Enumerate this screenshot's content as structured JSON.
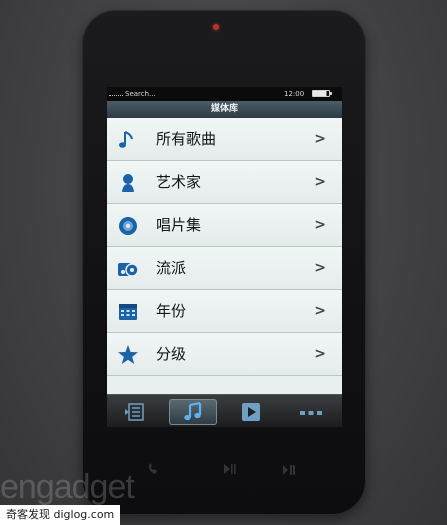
{
  "status_bar": {
    "search_label": "Search...",
    "time": "12:00",
    "battery_icon": "battery-icon"
  },
  "header": {
    "title": "媒体库"
  },
  "menu": {
    "items": [
      {
        "label": "所有歌曲",
        "icon": "music-note-icon",
        "chevron": ">"
      },
      {
        "label": "艺术家",
        "icon": "artist-icon",
        "chevron": ">"
      },
      {
        "label": "唱片集",
        "icon": "album-icon",
        "chevron": ">"
      },
      {
        "label": "流派",
        "icon": "genre-icon",
        "chevron": ">"
      },
      {
        "label": "年份",
        "icon": "calendar-icon",
        "chevron": ">"
      },
      {
        "label": "分级",
        "icon": "star-icon",
        "chevron": ">"
      }
    ]
  },
  "tab_bar": {
    "tabs": [
      {
        "icon": "playlist-icon"
      },
      {
        "icon": "music-note-icon",
        "active": true
      },
      {
        "icon": "video-icon"
      },
      {
        "icon": "more-icon"
      }
    ]
  },
  "watermarks": {
    "site_logo": "engadget",
    "site_caption": "奇客发现 diglog.com"
  },
  "colors": {
    "accent_icon": "#1b63a8",
    "list_background": "#e8efee",
    "title_bar": "#2c3a43"
  }
}
